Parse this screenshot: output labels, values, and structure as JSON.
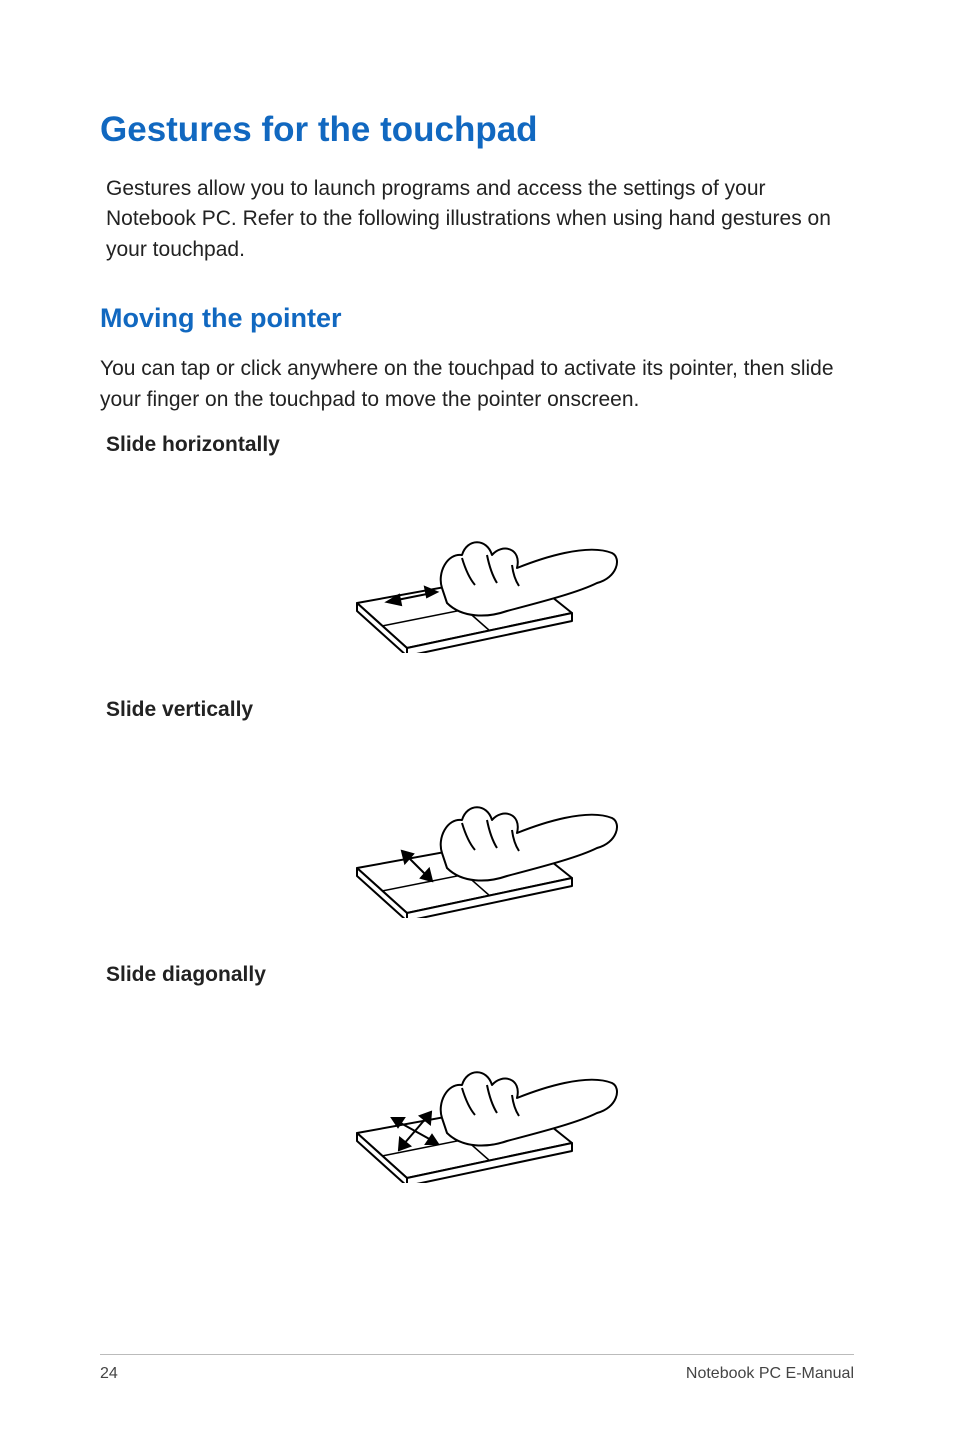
{
  "headings": {
    "main": "Gestures for the touchpad",
    "sub": "Moving the pointer"
  },
  "paragraphs": {
    "intro": "Gestures allow you to launch programs and access the settings of your Notebook PC. Refer to the following illustrations when using hand gestures on your touchpad.",
    "pointer": "You can tap or click anywhere on the touchpad to activate its pointer, then slide your finger on the touchpad to move the pointer onscreen."
  },
  "labels": {
    "slide_h": "Slide horizontally",
    "slide_v": "Slide vertically",
    "slide_d": "Slide diagonally"
  },
  "footer": {
    "page": "24",
    "title": "Notebook PC E-Manual"
  }
}
